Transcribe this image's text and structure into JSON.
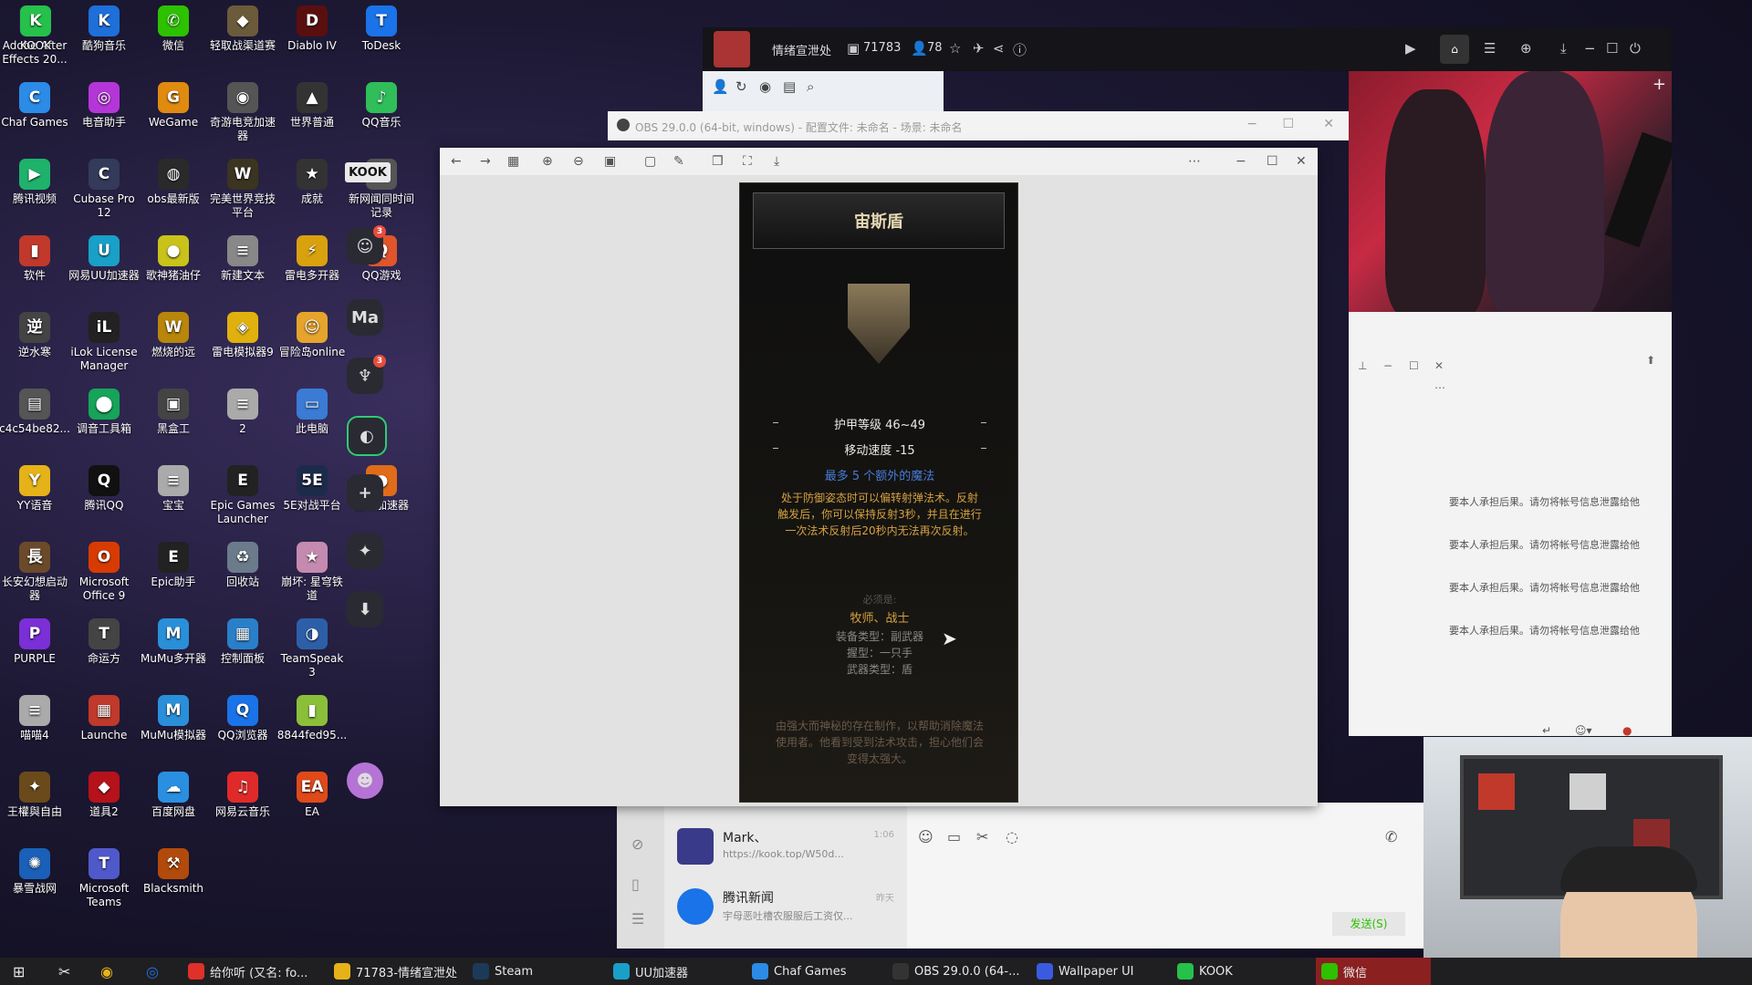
{
  "desktop": {
    "icons": [
      {
        "label": "Adobe After Effects 20...",
        "glyph": "Ae",
        "color": "#2b1b4a"
      },
      {
        "label": "酷狗音乐",
        "glyph": "K",
        "color": "#1e6fd9"
      },
      {
        "label": "微信",
        "glyph": "✆",
        "color": "#2dc100"
      },
      {
        "label": "轻取战渠道赛",
        "glyph": "◆",
        "color": "#6b5b3a"
      },
      {
        "label": "Diablo IV",
        "glyph": "D",
        "color": "#5a0f0f"
      },
      {
        "label": "ToDesk",
        "glyph": "T",
        "color": "#1a73e8"
      },
      {
        "label": "KOOK",
        "glyph": "K",
        "color": "#25c14b"
      },
      {
        "label": "Chaf Games",
        "glyph": "C",
        "color": "#2b8be6"
      },
      {
        "label": "电音助手",
        "glyph": "◎",
        "color": "#b536d8"
      },
      {
        "label": "WeGame",
        "glyph": "G",
        "color": "#e08a10"
      },
      {
        "label": "奇游电竞加速器",
        "glyph": "◉",
        "color": "#555"
      },
      {
        "label": "世界普通",
        "glyph": "▲",
        "color": "#333"
      },
      {
        "label": "QQ音乐",
        "glyph": "♪",
        "color": "#2fbe5a"
      },
      {
        "label": "腾讯视频",
        "glyph": "▶",
        "color": "#1fb26b"
      },
      {
        "label": "Cubase Pro 12",
        "glyph": "C",
        "color": "#333a5a"
      },
      {
        "label": "obs最新版",
        "glyph": "◍",
        "color": "#2a2a2a"
      },
      {
        "label": "完美世界竞技平台",
        "glyph": "W",
        "color": "#3a3420"
      },
      {
        "label": "成就",
        "glyph": "★",
        "color": "#333"
      },
      {
        "label": "新网闻同时间记录",
        "glyph": "✂",
        "color": "#555"
      },
      {
        "label": "软件",
        "glyph": "▮",
        "color": "#c0392b"
      },
      {
        "label": "网易UU加速器",
        "glyph": "U",
        "color": "#18a0c8"
      },
      {
        "label": "歌神猪油仔",
        "glyph": "●",
        "color": "#c8c21a"
      },
      {
        "label": "新建文本",
        "glyph": "≡",
        "color": "#888"
      },
      {
        "label": "雷电多开器",
        "glyph": "⚡",
        "color": "#d9a10e"
      },
      {
        "label": "QQ游戏",
        "glyph": "Q",
        "color": "#e0552a"
      },
      {
        "label": "逆水寒",
        "glyph": "逆",
        "color": "#444"
      },
      {
        "label": "iLok License Manager",
        "glyph": "iL",
        "color": "#222"
      },
      {
        "label": "燃烧的远",
        "glyph": "W",
        "color": "#b8860b"
      },
      {
        "label": "雷电模拟器9",
        "glyph": "◈",
        "color": "#e0b10e"
      },
      {
        "label": "冒险岛online",
        "glyph": "☺",
        "color": "#e6a42c"
      },
      {
        "label": "c4c54be82...",
        "glyph": "▤",
        "color": "#555"
      },
      {
        "label": "调音工具箱",
        "glyph": "⬤",
        "color": "#16a35a"
      },
      {
        "label": "黑盒工",
        "glyph": "▣",
        "color": "#444"
      },
      {
        "label": "2",
        "glyph": "≡",
        "color": "#aaa"
      },
      {
        "label": "此电脑",
        "glyph": "▭",
        "color": "#3a7bd5"
      },
      {
        "label": "YY语音",
        "glyph": "Y",
        "color": "#e5b219"
      },
      {
        "label": "腾讯QQ",
        "glyph": "Q",
        "color": "#111"
      },
      {
        "label": "宝宝",
        "glyph": "≡",
        "color": "#aaa"
      },
      {
        "label": "Epic Games Launcher",
        "glyph": "E",
        "color": "#222"
      },
      {
        "label": "5E对战平台",
        "glyph": "5E",
        "color": "#1d2b4a"
      },
      {
        "label": "雷神加速器",
        "glyph": "●",
        "color": "#e06c1a"
      },
      {
        "label": "长安幻想启动器",
        "glyph": "長",
        "color": "#6a4a2a"
      },
      {
        "label": "Microsoft Office 9",
        "glyph": "O",
        "color": "#d83b01"
      },
      {
        "label": "Epic助手",
        "glyph": "E",
        "color": "#222"
      },
      {
        "label": "回收站",
        "glyph": "♻",
        "color": "#6b7b8c"
      },
      {
        "label": "崩坏: 星穹铁道",
        "glyph": "★",
        "color": "#c58ab0"
      },
      {
        "label": "PURPLE",
        "glyph": "P",
        "color": "#7b2fd6"
      },
      {
        "label": "命运方",
        "glyph": "T",
        "color": "#444"
      },
      {
        "label": "MuMu多开器",
        "glyph": "M",
        "color": "#2a8fd9"
      },
      {
        "label": "控制面板",
        "glyph": "▦",
        "color": "#2a7fc9"
      },
      {
        "label": "TeamSpeak 3",
        "glyph": "◑",
        "color": "#2d5fa8"
      },
      {
        "label": "喵喵4",
        "glyph": "≡",
        "color": "#aaa"
      },
      {
        "label": "Launche",
        "glyph": "▦",
        "color": "#c0392b"
      },
      {
        "label": "MuMu模拟器",
        "glyph": "M",
        "color": "#2a8fd9"
      },
      {
        "label": "QQ浏览器",
        "glyph": "Q",
        "color": "#1a73e8"
      },
      {
        "label": "8844fed95...",
        "glyph": "▮",
        "color": "#8bbf3a"
      },
      {
        "label": "王權與自由",
        "glyph": "✦",
        "color": "#6a4a1a"
      },
      {
        "label": "道具2",
        "glyph": "◆",
        "color": "#b5121b"
      },
      {
        "label": "百度网盘",
        "glyph": "☁",
        "color": "#2a8fe0"
      },
      {
        "label": "网易云音乐",
        "glyph": "♫",
        "color": "#e02a2a"
      },
      {
        "label": "EA",
        "glyph": "EA",
        "color": "#e04a1a"
      },
      {
        "label": "暴雪战网",
        "glyph": "✺",
        "color": "#1a5fb8"
      },
      {
        "label": "Microsoft Teams",
        "glyph": "T",
        "color": "#5059c9"
      },
      {
        "label": "Blacksmith",
        "glyph": "⚒",
        "color": "#b24a0c"
      }
    ]
  },
  "kook_sidebar": {
    "logo": "KOOK",
    "ma": "Ma",
    "badge1": "3",
    "badge2": "3"
  },
  "live_app": {
    "title": "情绪宣泄处",
    "room_id": "71783",
    "viewers": "78"
  },
  "obs": {
    "title": "OBS 29.0.0 (64-bit, windows) - 配置文件: 未命名 - 场景: 未命名"
  },
  "item_card": {
    "name": "宙斯盾",
    "armor": "护甲等级 46~49",
    "move": "移动速度 -15",
    "magic": "最多 5 个额外的魔法",
    "effect": "处于防御姿态时可以偏转射弹法术。反射触发后，你可以保持反射3秒，并且在进行一次法术反射后20秒内无法再次反射。",
    "req_label": "必须是:",
    "req": "牧师、战士",
    "slot_type": "装备类型：副武器",
    "hand": "握型：一只手",
    "weapon_type": "武器类型：盾",
    "lore": "由强大而神秘的存在制作，以帮助消除魔法使用者。他看到受到法术攻击，担心他们会变得太强大。"
  },
  "chat_window": {
    "notice": "要本人承担后果。请勿将帐号信息泄露给他"
  },
  "chat_list": [
    {
      "name": "Mark、",
      "preview": "https://kook.top/W50d...",
      "time": "1:06"
    },
    {
      "name": "腾讯新闻",
      "preview": "宇母恶吐槽农服服后工资仅...",
      "time": "昨天"
    }
  ],
  "chat_input": {
    "send": "发送(S)"
  },
  "taskbar": {
    "items": [
      {
        "label": "给你听 (又名: fo...",
        "color": "#e0302a"
      },
      {
        "label": "71783-情绪宣泄处",
        "color": "#e6b219"
      },
      {
        "label": "Steam",
        "color": "#1b3a5a"
      },
      {
        "label": "UU加速器",
        "color": "#18a0c8"
      },
      {
        "label": "Chaf Games",
        "color": "#2b8be6"
      },
      {
        "label": "OBS 29.0.0 (64-...",
        "color": "#333"
      },
      {
        "label": "Wallpaper UI",
        "color": "#3a5be0"
      },
      {
        "label": "KOOK",
        "color": "#25c14b"
      },
      {
        "label": "微信",
        "color": "#2dc100"
      }
    ]
  }
}
